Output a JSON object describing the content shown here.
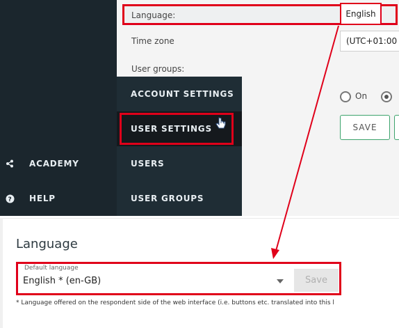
{
  "sidebar": {
    "items": [
      {
        "label": "ACADEMY",
        "icon": "share-icon"
      },
      {
        "label": "HELP",
        "icon": "help-icon"
      }
    ]
  },
  "submenu": {
    "items": [
      {
        "label": "ACCOUNT SETTINGS"
      },
      {
        "label": "USER SETTINGS",
        "active": true
      },
      {
        "label": "USERS"
      },
      {
        "label": "USER GROUPS"
      }
    ]
  },
  "settings": {
    "language_label": "Language:",
    "language_value": "English",
    "timezone_label": "Time zone",
    "timezone_value": "(UTC+01:00",
    "user_groups_label": "User groups:",
    "radio_on_label": "On",
    "save_label": "SAVE"
  },
  "language_section": {
    "title": "Language",
    "field_legend": "Default language",
    "field_value": "English * (en-GB)",
    "save_label": "Save",
    "footnote": "* Language offered on the respondent side of the web interface (i.e. buttons etc. translated into this l"
  },
  "colors": {
    "highlight": "#e0001a",
    "sidebar_bg": "#1b262d",
    "accent_green": "#3ca36c"
  }
}
